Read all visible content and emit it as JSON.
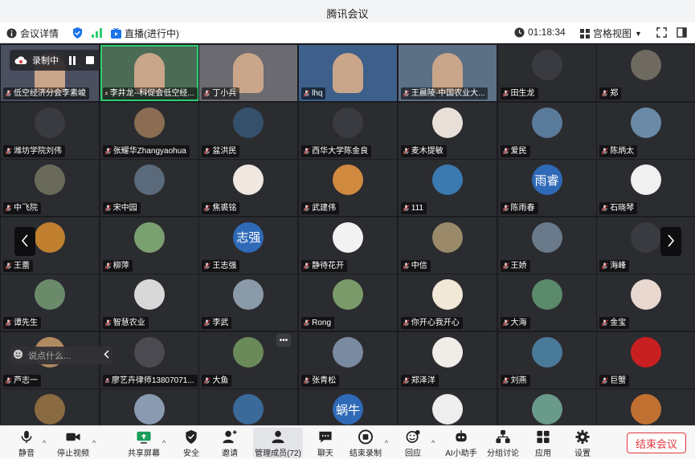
{
  "window": {
    "title": "腾讯会议"
  },
  "infobar": {
    "details": "会议详情",
    "live": "直播(进行中)",
    "timer": "01:18:34",
    "view": "宫格视图"
  },
  "recording": {
    "label": "录制中"
  },
  "chat": {
    "placeholder": "说点什么..."
  },
  "tiles": [
    {
      "name": "低空经济分会李素峻",
      "bg": "#4a5060"
    },
    {
      "name": "李井龙--科促会低空经...",
      "bg": "#4b6b55"
    },
    {
      "name": "丁小兵",
      "bg": "#6a6a70"
    },
    {
      "name": "lhq",
      "bg": "#3d5f8a"
    },
    {
      "name": "王晨陵-中国农业大...",
      "bg": "#5b6f85"
    },
    {
      "name": "田生龙",
      "bg": "#3a3b40"
    },
    {
      "name": "郑",
      "bg": "#6f6a5f"
    },
    {
      "name": "潍坊学院刘伟",
      "bg": "#3a3b40"
    },
    {
      "name": "张耀华Zhangyaohua",
      "bg": "#8a6d52"
    },
    {
      "name": "盆洪民",
      "bg": "#35506b"
    },
    {
      "name": "西华大学陈金良",
      "bg": "#3a3b40"
    },
    {
      "name": "麦木提敏",
      "bg": "#e8e0d8"
    },
    {
      "name": "爱民",
      "bg": "#5a7a9a"
    },
    {
      "name": "陈炳太",
      "bg": "#6a8aa8"
    },
    {
      "name": "中飞院",
      "bg": "#6a6a5a"
    },
    {
      "name": "宋中园",
      "bg": "#5a6a7a"
    },
    {
      "name": "焦裘铭",
      "bg": "#f0e8e0"
    },
    {
      "name": "武建伟",
      "bg": "#d08a40"
    },
    {
      "name": "111",
      "bg": "#3a7ab0"
    },
    {
      "name": "陈雨春",
      "bg": "#2f6ab8",
      "text": "雨睿"
    },
    {
      "name": "石晓琴",
      "bg": "#f0f0f0"
    },
    {
      "name": "王蕾",
      "bg": "#c08030"
    },
    {
      "name": "柳萍",
      "bg": "#7aa070"
    },
    {
      "name": "王志强",
      "bg": "#2f6ab8",
      "text": "志强"
    },
    {
      "name": "静待花开",
      "bg": "#f2f2f2"
    },
    {
      "name": "中信",
      "bg": "#9a8a6a"
    },
    {
      "name": "王娇",
      "bg": "#6a7a8a"
    },
    {
      "name": "海峰",
      "bg": "#3a3b40"
    },
    {
      "name": "谭先生",
      "bg": "#6a8a6a"
    },
    {
      "name": "智慧农业",
      "bg": "#d8d8d8"
    },
    {
      "name": "李武",
      "bg": "#8a9aa8"
    },
    {
      "name": "Rong",
      "bg": "#7a9a6a"
    },
    {
      "name": "你开心我开心",
      "bg": "#f2e8d8"
    },
    {
      "name": "大海",
      "bg": "#5a8a6a"
    },
    {
      "name": "金宝",
      "bg": "#e8d8d0"
    },
    {
      "name": "芦志一",
      "bg": "#b08a60"
    },
    {
      "name": "廖艺卉律师13807071...",
      "bg": "#4a4a50"
    },
    {
      "name": "大鱼",
      "bg": "#6a8a5a"
    },
    {
      "name": "张青松",
      "bg": "#7a8aa0"
    },
    {
      "name": "郑泽洋",
      "bg": "#f0ece8"
    },
    {
      "name": "刘燕",
      "bg": "#4a7a9a"
    },
    {
      "name": "巨蟹",
      "bg": "#c82020"
    },
    {
      "name": "",
      "bg": "#8a6a40"
    },
    {
      "name": "",
      "bg": "#8a9ab0"
    },
    {
      "name": "",
      "bg": "#3a6a9a"
    },
    {
      "name": "",
      "bg": "#2f6ab8",
      "text": "蜗牛"
    },
    {
      "name": "",
      "bg": "#eeeeee"
    },
    {
      "name": "",
      "bg": "#6a9a8a"
    },
    {
      "name": "",
      "bg": "#c07030"
    }
  ],
  "toolbar": {
    "mute": "静音",
    "video": "停止视频",
    "share": "共享屏幕",
    "security": "安全",
    "invite": "邀请",
    "members": "管理成员(72)",
    "chat": "聊天",
    "record": "结束录制",
    "replay": "回应",
    "ai": "AI小助手",
    "groups": "分组讨论",
    "apps": "应用",
    "settings": "设置",
    "end": "结束会议"
  }
}
